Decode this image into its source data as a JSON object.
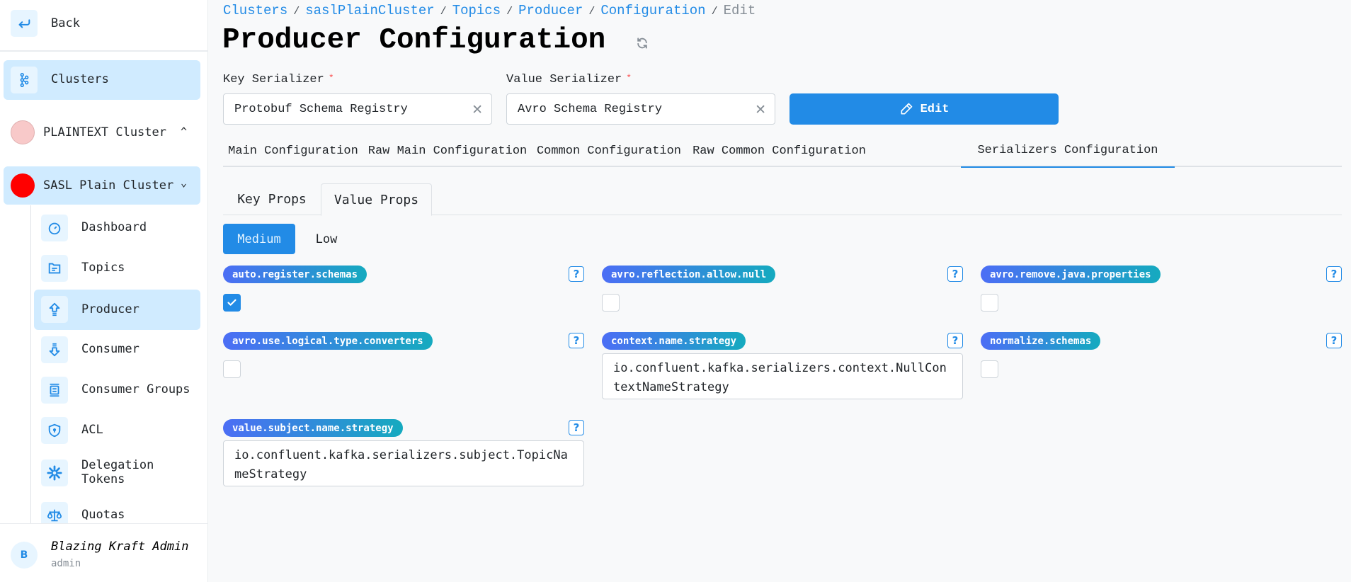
{
  "sidebar": {
    "back_label": "Back",
    "clusters_label": "Clusters",
    "clusters": [
      {
        "name": "PLAINTEXT Cluster",
        "color": "#f8c9c9",
        "expanded": false
      },
      {
        "name": "SASL Plain Cluster",
        "color": "#ff0000",
        "expanded": true
      }
    ],
    "items": [
      {
        "label": "Dashboard",
        "icon": "dashboard-icon"
      },
      {
        "label": "Topics",
        "icon": "folder-icon"
      },
      {
        "label": "Producer",
        "icon": "upload-arrow-icon",
        "active": true
      },
      {
        "label": "Consumer",
        "icon": "download-arrow-icon"
      },
      {
        "label": "Consumer Groups",
        "icon": "group-icon"
      },
      {
        "label": "ACL",
        "icon": "shield-icon"
      },
      {
        "label": "Delegation Tokens",
        "icon": "token-icon"
      },
      {
        "label": "Quotas",
        "icon": "scale-icon"
      }
    ],
    "user": {
      "initial": "B",
      "name": "Blazing Kraft Admin",
      "role": "admin"
    }
  },
  "breadcrumb": [
    {
      "label": "Clusters",
      "link": true
    },
    {
      "label": "saslPlainCluster",
      "link": true
    },
    {
      "label": "Topics",
      "link": true
    },
    {
      "label": "Producer",
      "link": true
    },
    {
      "label": "Configuration",
      "link": true
    },
    {
      "label": "Edit",
      "link": false
    }
  ],
  "page_title": "Producer Configuration",
  "serializers": {
    "key_label": "Key Serializer",
    "key_value": "Protobuf Schema Registry",
    "value_label": "Value Serializer",
    "value_value": "Avro Schema Registry",
    "required_mark": "*"
  },
  "edit_button": "Edit",
  "tabs": [
    {
      "label": "Main Configuration"
    },
    {
      "label": "Raw Main Configuration"
    },
    {
      "label": "Common Configuration"
    },
    {
      "label": "Raw Common Configuration"
    },
    {
      "label": "Serializers Configuration",
      "active": true
    }
  ],
  "subtabs": [
    {
      "label": "Key Props"
    },
    {
      "label": "Value Props",
      "active": true
    }
  ],
  "importance": [
    {
      "label": "Medium",
      "active": true
    },
    {
      "label": "Low"
    }
  ],
  "props": [
    {
      "name": "auto.register.schemas",
      "type": "checkbox",
      "checked": true
    },
    {
      "name": "avro.reflection.allow.null",
      "type": "checkbox",
      "checked": false
    },
    {
      "name": "avro.remove.java.properties",
      "type": "checkbox",
      "checked": false
    },
    {
      "name": "avro.use.logical.type.converters",
      "type": "checkbox",
      "checked": false
    },
    {
      "name": "context.name.strategy",
      "type": "text",
      "value": "io.confluent.kafka.serializers.context.NullContextNameStrategy"
    },
    {
      "name": "normalize.schemas",
      "type": "checkbox",
      "checked": false
    },
    {
      "name": "value.subject.name.strategy",
      "type": "text",
      "value": "io.confluent.kafka.serializers.subject.TopicNameStrategy"
    }
  ],
  "help_glyph": "?",
  "colors": {
    "accent": "#228be6",
    "active_bg": "#d0ebff",
    "badge_from": "#4c6ef5",
    "badge_to": "#15aabf"
  }
}
